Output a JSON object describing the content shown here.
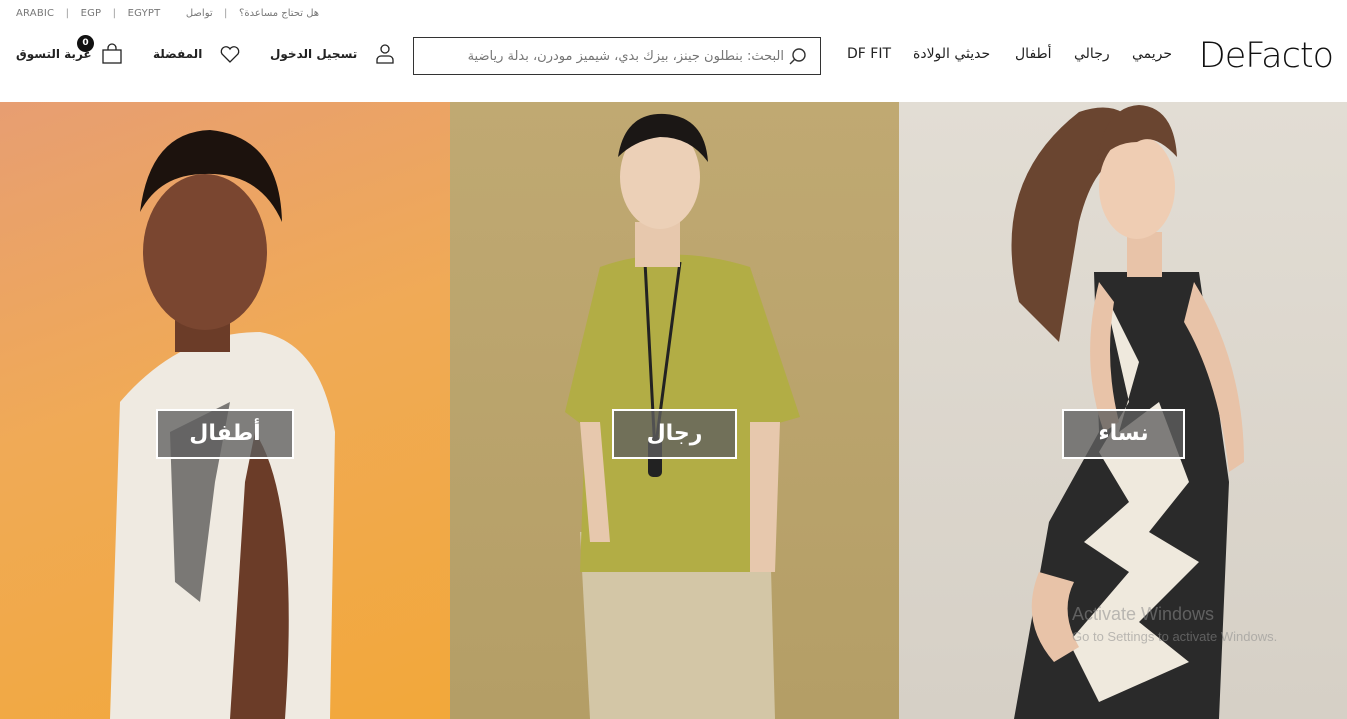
{
  "topbar": {
    "language": "ARABIC",
    "currency": "EGP",
    "country": "EGYPT",
    "contact": "تواصل",
    "help": "هل تحتاج مساعدة؟"
  },
  "header": {
    "logo": "DeFacto",
    "nav": [
      "حريمي",
      "رجالي",
      "أطفال",
      "حديثي الولادة",
      "DF FIT"
    ],
    "search_placeholder": "البحث: بنطلون جينز، بيزك بدي، شيميز مودرن، بدلة رياضية",
    "login_label": "تسجيل الدخول",
    "favorites_label": "المفضلة",
    "cart_label": "عربة التسوق",
    "cart_count": "0"
  },
  "categories": [
    {
      "label": "أطفال",
      "color": "#f0a94c"
    },
    {
      "label": "رجال",
      "color": "#b8a26a"
    },
    {
      "label": "نساء",
      "color": "#dcd6cc"
    }
  ],
  "watermark": {
    "line1": "Activate Windows",
    "line2": "Go to Settings to activate Windows."
  }
}
